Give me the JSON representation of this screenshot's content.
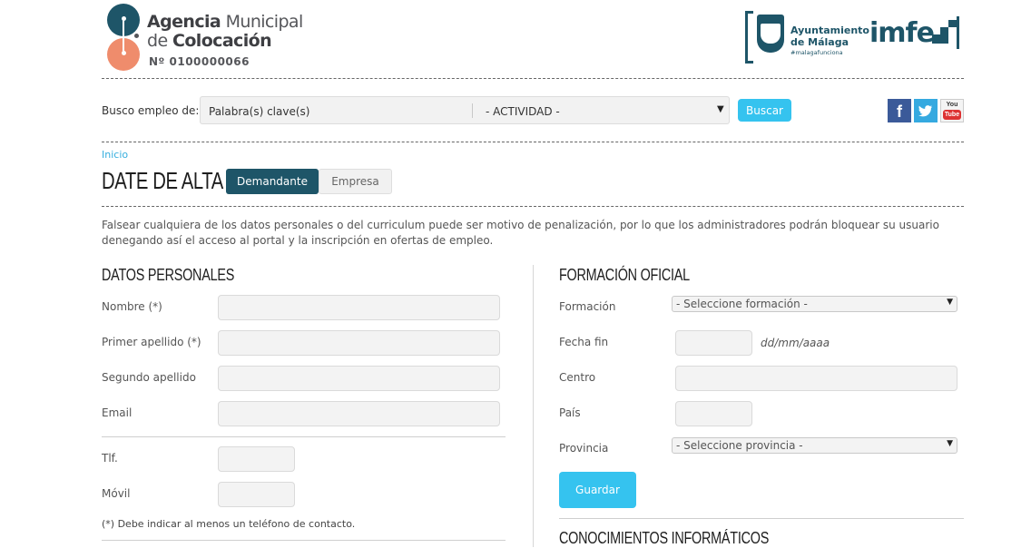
{
  "header": {
    "brand_line1_normal": "Agencia ",
    "brand_line1_bold": "Agencia",
    "brand_line1_rest": "Municipal",
    "brand_line2_normal": "de ",
    "brand_line2_bold": "Colocación",
    "brand_number": "Nº 0100000066",
    "ayto_line1": "Ayuntamiento",
    "ayto_line2": "de Málaga",
    "ayto_tag": "#malagafunciona",
    "imfe_text": "imfe"
  },
  "search": {
    "label": "Busco empleo de:",
    "keyword_placeholder": "Palabra(s) clave(s)",
    "activity_value": "- ACTIVIDAD -",
    "button_label": "Buscar"
  },
  "social": {
    "facebook": "f",
    "twitter": "🐦",
    "youtube_you": "You",
    "youtube_tube": "Tube"
  },
  "breadcrumb": {
    "home": "Inicio"
  },
  "page": {
    "title": "DATE DE ALTA |",
    "tab_demandante": "Demandante",
    "tab_empresa": "Empresa",
    "warning": "Falsear cualquiera de los datos personales o del curriculum puede ser motivo de penalización, por lo que los administradores podrán bloquear su usuario denegando así el acceso al portal y la inscripción en ofertas de empleo."
  },
  "personal": {
    "heading": "DATOS PERSONALES",
    "nombre": "Nombre (*)",
    "apellido1": "Primer apellido (*)",
    "apellido2": "Segundo apellido",
    "email": "Email",
    "tlf": "Tlf.",
    "movil": "Móvil",
    "note": "(*) Debe indicar al menos un teléfono de contacto."
  },
  "formacion": {
    "heading": "FORMACIÓN OFICIAL",
    "formacion_label": "Formación",
    "formacion_value": "- Seleccione formación -",
    "fecha_label": "Fecha fin",
    "fecha_hint": "dd/mm/aaaa",
    "centro_label": "Centro",
    "pais_label": "País",
    "provincia_label": "Provincia",
    "provincia_value": "- Seleccione provincia -",
    "save_label": "Guardar"
  },
  "informatica": {
    "heading": "CONOCIMIENTOS INFORMÁTICOS"
  },
  "colors": {
    "primary": "#1e5568",
    "accent": "#35c3ef",
    "logo_orange": "#ef8c6c",
    "link": "#35aede"
  },
  "icons": {
    "select_arrow": "▼"
  }
}
